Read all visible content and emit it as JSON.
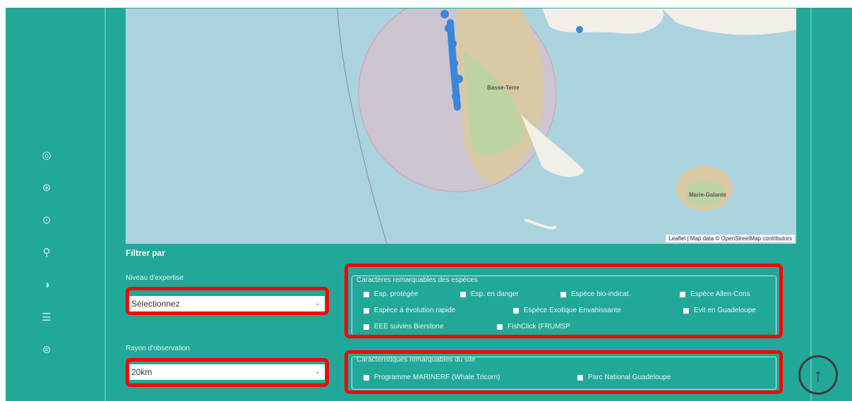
{
  "map": {
    "attribution": "Leaflet | Map data © OpenStreetMap contributors",
    "labels": [
      "Basse-Terre",
      "Marie-Galante"
    ]
  },
  "filter": {
    "title": "Filtrer par",
    "expertise": {
      "label": "Niveau d'expertise",
      "value": "Sélectionnez"
    },
    "radius": {
      "label": "Rayon d'observation",
      "value": "20km"
    },
    "species_group": {
      "legend": "Caractères remarquables des espèces",
      "options": [
        "Esp. protégée",
        "Esp. en danger",
        "Espèce bio-indicat.",
        "Espèce Allen-Cons",
        "Espèce à évolution rapide",
        "Espèce Exotique Envahissante",
        "Evit en Guadeloupe",
        "EEE suivies Bierstone",
        "FishClick (FRUMSP"
      ]
    },
    "site_group": {
      "legend": "Caractéristiques remarquables du site",
      "options": [
        "Programme MARINERF (Whale Tricorn)",
        "Parc National Guadeloupe"
      ]
    }
  },
  "scroll_top_icon": "arrow-up-circle-icon"
}
